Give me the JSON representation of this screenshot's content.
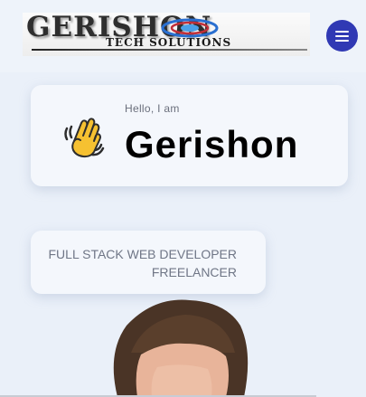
{
  "header": {
    "logo_top_text": "GERISHON",
    "logo_bottom_text": "TECH SOLUTIONS",
    "menu_icon": "hamburger-icon",
    "menu_color": "#3039b4"
  },
  "intro": {
    "greeting": "Hello, I am",
    "name": "Gerishon",
    "wave_icon": "waving-hand-icon"
  },
  "role": {
    "line1": "FULL STACK WEB DEVELOPER",
    "line2": "FREELANCER"
  },
  "colors": {
    "background": "#eaf0f9",
    "card": "#f4f7fc",
    "accent": "#3039b4"
  }
}
